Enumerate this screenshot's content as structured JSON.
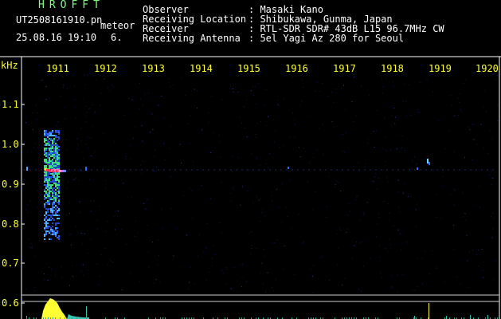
{
  "header": {
    "app_title": "HROFFT",
    "file_name": "UT2508161910.pn",
    "meteor_label": "meteor",
    "datetime": "25.08.16 19:10",
    "meteor_count": "6."
  },
  "info": {
    "observer_key": "Observer",
    "observer_val": ": Masaki Kano",
    "location_key": "Receiving Location",
    "location_val": ": Shibukawa, Gunma, Japan",
    "receiver_key": "Receiver",
    "receiver_val": ": RTL-SDR SDR# 43dB L15 96.7MHz CW",
    "antenna_key": "Receiving Antenna",
    "antenna_val": ": 5el Yagi Az 280 for Seoul"
  },
  "time_axis": {
    "labels": [
      "1911",
      "1912",
      "1913",
      "1914",
      "1915",
      "1916",
      "1917",
      "1918",
      "1919",
      "1920"
    ]
  },
  "freq_axis": {
    "unit": "kHz",
    "labels": [
      "1.1",
      "1.0",
      "0.9",
      "0.8",
      "0.7",
      "0.6"
    ]
  },
  "colors": {
    "background": "#000000",
    "grid": "#ffffff",
    "text_green": "#7CFF7C",
    "text_yellow": "#ffff33",
    "echo_hot": "#ff3355",
    "echo_cold": "#2233aa"
  }
}
